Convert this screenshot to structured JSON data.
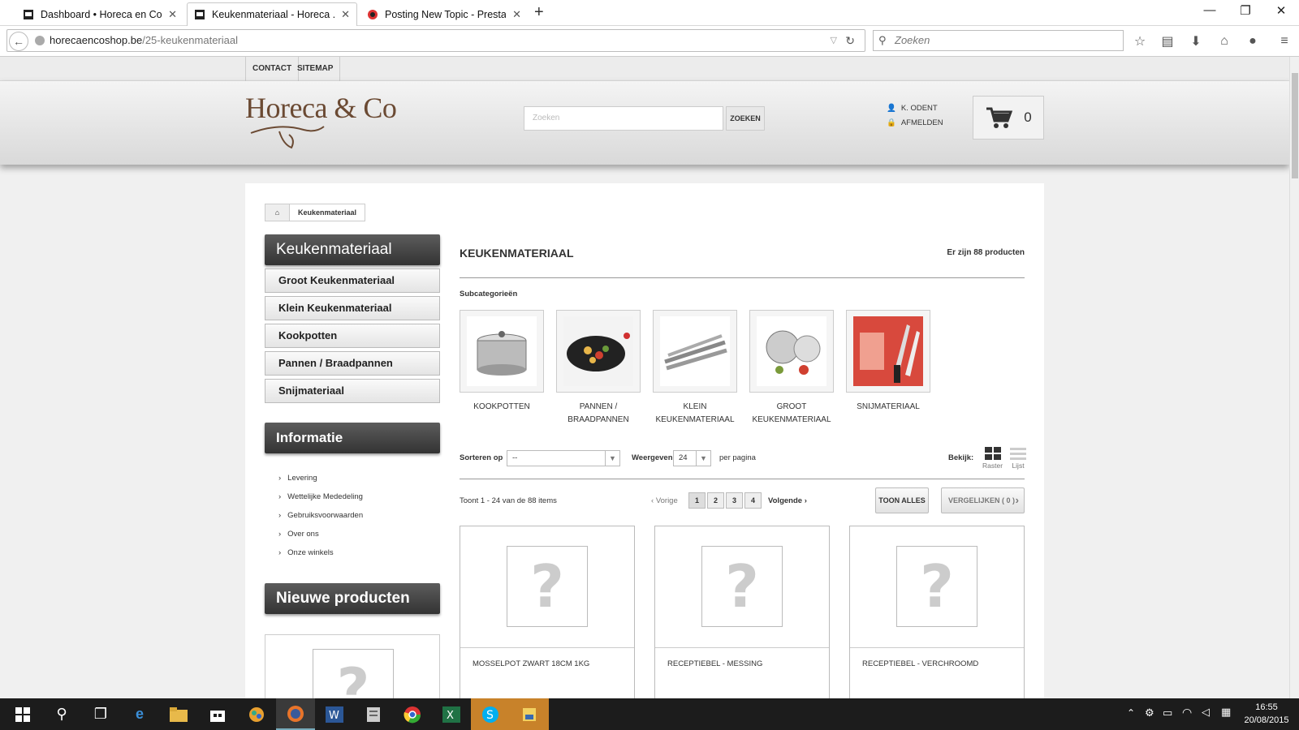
{
  "browser": {
    "tabs": [
      {
        "label": "Dashboard • Horeca en Co ..."
      },
      {
        "label": "Keukenmateriaal - Horeca ..."
      },
      {
        "label": "Posting New Topic - Presta..."
      }
    ],
    "url_host": "horecaencoshop.be",
    "url_path": "/25-keukenmateriaal",
    "search_placeholder": "Zoeken"
  },
  "topbar": {
    "contact": "CONTACT",
    "sitemap": "SITEMAP"
  },
  "header": {
    "logo_text": "Horeca & Co",
    "search_placeholder": "Zoeken",
    "search_button": "ZOEKEN",
    "account_name": "K. ODENT",
    "logout": "AFMELDEN",
    "cart_count": "0"
  },
  "breadcrumb": {
    "current": "Keukenmateriaal"
  },
  "sidebar": {
    "category_title": "Keukenmateriaal",
    "categories": [
      "Groot Keukenmateriaal",
      "Klein Keukenmateriaal",
      "Kookpotten",
      "Pannen / Braadpannen",
      "Snijmateriaal"
    ],
    "info_title": "Informatie",
    "info_links": [
      "Levering",
      "Wettelijke Mededeling",
      "Gebruiksvoorwaarden",
      "Over ons",
      "Onze winkels"
    ],
    "new_title": "Nieuwe producten",
    "new_placeholder": "?"
  },
  "main": {
    "title": "KEUKENMATERIAAL",
    "count": "Er zijn 88 producten",
    "subcategories_label": "Subcategorieën",
    "subcategories": [
      {
        "line1": "KOOKPOTTEN",
        "line2": ""
      },
      {
        "line1": "PANNEN /",
        "line2": "BRAADPANNEN"
      },
      {
        "line1": "KLEIN",
        "line2": "KEUKENMATERIAAL"
      },
      {
        "line1": "GROOT",
        "line2": "KEUKENMATERIAAL"
      },
      {
        "line1": "SNIJMATERIAAL",
        "line2": ""
      }
    ],
    "sort_label": "Sorteren op",
    "sort_value": "--",
    "show_label": "Weergeven",
    "show_value": "24",
    "per_page": "per pagina",
    "view_label": "Bekijk:",
    "view_grid": "Raster",
    "view_list": "Lijst",
    "showing": "Toont 1 - 24 van de 88 items",
    "prev": "Vorige",
    "pages": [
      "1",
      "2",
      "3",
      "4"
    ],
    "next": "Volgende",
    "show_all": "TOON ALLES",
    "compare": "VERGELIJKEN ( 0 )",
    "products": [
      {
        "name": "MOSSELPOT ZWART 18CM 1KG",
        "image": "?"
      },
      {
        "name": "RECEPTIEBEL - MESSING",
        "image": "?"
      },
      {
        "name": "RECEPTIEBEL - VERCHROOMD",
        "image": "?"
      }
    ]
  },
  "taskbar": {
    "time": "16:55",
    "date": "20/08/2015"
  }
}
